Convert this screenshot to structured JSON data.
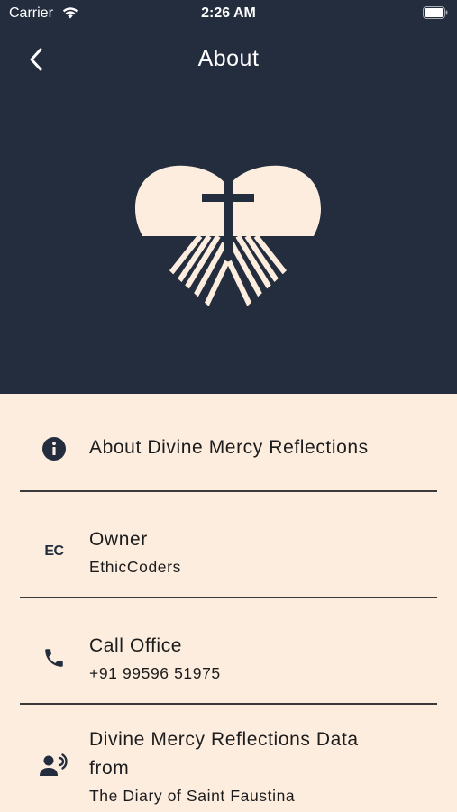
{
  "status_bar": {
    "carrier": "Carrier",
    "time": "2:26 AM"
  },
  "header": {
    "title": "About"
  },
  "colors": {
    "header_bg": "#232D3E",
    "content_bg": "#FDEDDF",
    "logo": "#FDEDDF",
    "icon": "#232D3E"
  },
  "items": [
    {
      "icon": "info-icon",
      "primary": "About Divine Mercy Reflections"
    },
    {
      "icon": "ec-logo-icon",
      "icon_text": "EC",
      "primary": "Owner",
      "secondary": "EthicCoders"
    },
    {
      "icon": "phone-icon",
      "primary": "Call Office",
      "secondary": "+91 99596 51975"
    },
    {
      "icon": "record-voice-icon",
      "primary": "Divine Mercy Reflections Data from",
      "secondary": "The Diary of Saint Faustina"
    }
  ]
}
